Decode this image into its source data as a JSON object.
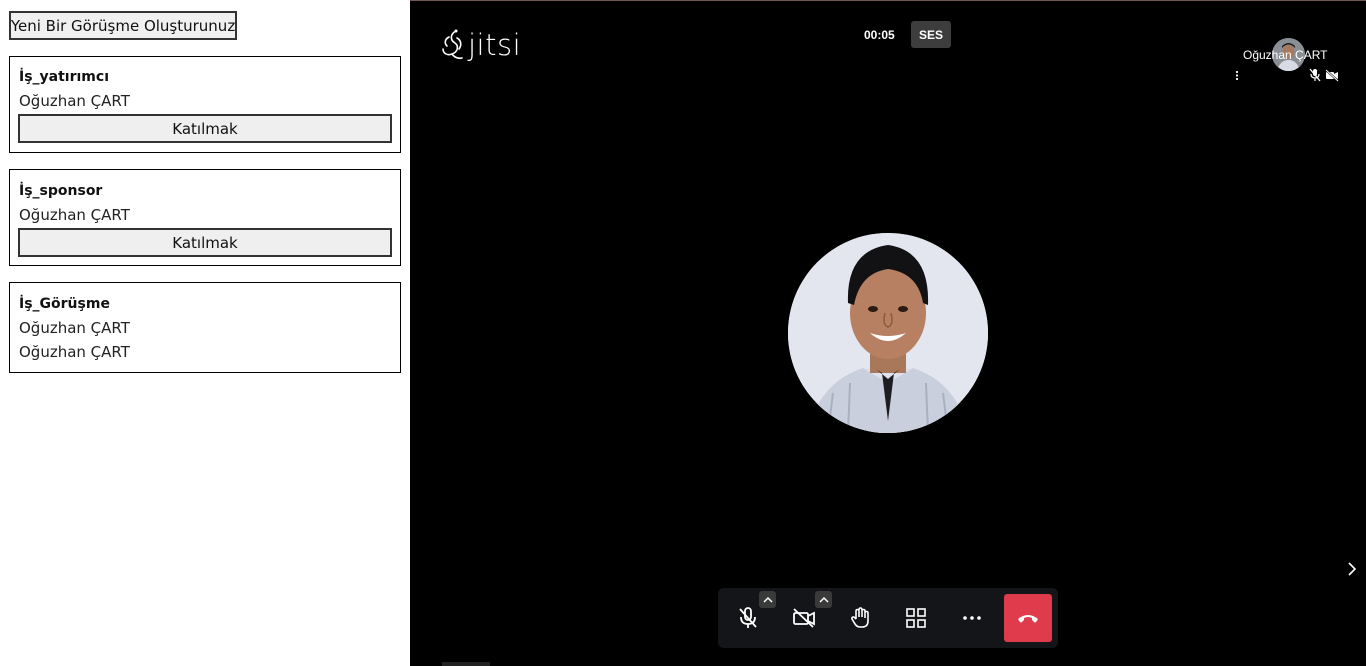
{
  "left_panel": {
    "new_meeting_button": "Yeni Bir Görüşme Oluşturunuz",
    "meetings": [
      {
        "title": "İş_yatırımcı",
        "owner": "Oğuzhan ÇART",
        "join_label": "Katılmak"
      },
      {
        "title": "İş_sponsor",
        "owner": "Oğuzhan ÇART",
        "join_label": "Katılmak"
      },
      {
        "title": "İş_Görüşme",
        "owner": "Oğuzhan ÇART",
        "second_line": "Oğuzhan ÇART"
      }
    ]
  },
  "meeting": {
    "logo_text": "jitsi",
    "timer": "00:05",
    "audio_badge": "SES",
    "participant_name": "Oğuzhan ÇART",
    "toolbar_icons": [
      "mic-muted-icon",
      "camera-off-icon",
      "raise-hand-icon",
      "tile-view-icon",
      "more-options-icon",
      "hangup-icon"
    ],
    "colors": {
      "background": "#000000",
      "toolbar": "#131519",
      "hangup": "#e03a4d",
      "badge": "#3d3d3d"
    }
  }
}
